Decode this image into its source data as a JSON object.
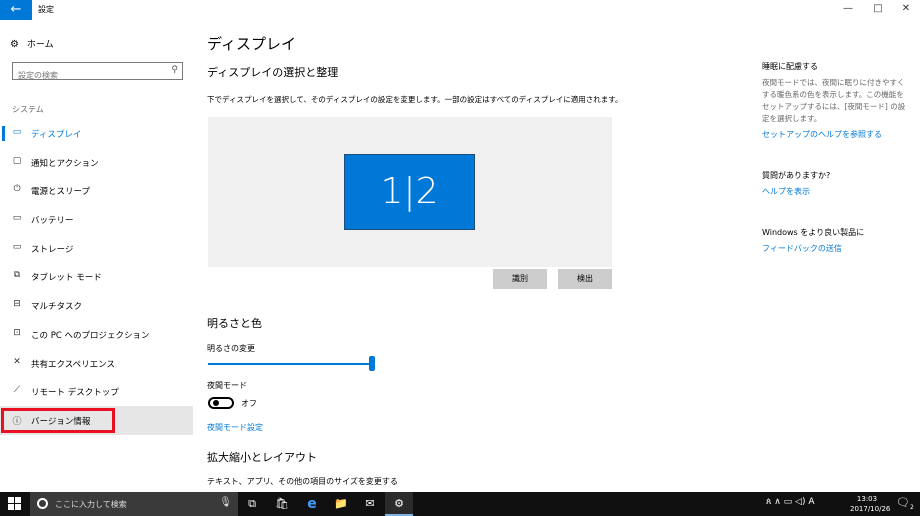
{
  "window": {
    "back_icon": "←",
    "title": "設定",
    "minimize": "—",
    "maximize": "□",
    "close": "✕"
  },
  "sidebar": {
    "home_icon": "⚙",
    "home_label": "ホーム",
    "search_placeholder": "設定の検索",
    "search_icon": "⚲",
    "section": "システム",
    "items": [
      {
        "icon": "▭",
        "label": "ディスプレイ"
      },
      {
        "icon": "▢",
        "label": "通知とアクション"
      },
      {
        "icon": "⏻",
        "label": "電源とスリープ"
      },
      {
        "icon": "▭",
        "label": "バッテリー"
      },
      {
        "icon": "▭",
        "label": "ストレージ"
      },
      {
        "icon": "⧉",
        "label": "タブレット モード"
      },
      {
        "icon": "⊟",
        "label": "マルチタスク"
      },
      {
        "icon": "⊡",
        "label": "この PC へのプロジェクション"
      },
      {
        "icon": "✕",
        "label": "共有エクスペリエンス"
      },
      {
        "icon": "⟋",
        "label": "リモート デスクトップ"
      },
      {
        "icon": "ⓘ",
        "label": "バージョン情報"
      }
    ]
  },
  "main": {
    "title": "ディスプレイ",
    "subtitle": "ディスプレイの選択と整理",
    "description": "下でディスプレイを選択して、そのディスプレイの設定を変更します。一部の設定はすべてのディスプレイに適用されます。",
    "monitor_label": "1|2",
    "identify_button": "識別",
    "detect_button": "検出",
    "brightness_section": "明るさと色",
    "brightness_label": "明るさの変更",
    "brightness_level": 1.0,
    "night_mode_label": "夜間モード",
    "night_mode_state": "オフ",
    "night_mode_link": "夜間モード設定",
    "scale_section": "拡大縮小とレイアウト",
    "scale_desc": "テキスト、アプリ、その他の項目のサイズを変更する"
  },
  "right": {
    "sleep_head": "睡眠に配慮する",
    "sleep_text": "夜間モードでは、夜間に眠りに付きやすくする暖色系の色を表示します。この機能をセットアップするには、[夜間モード] の設定を選択します。",
    "sleep_link": "セットアップのヘルプを参照する",
    "question_head": "質問がありますか?",
    "question_link": "ヘルプを表示",
    "improve_head": "Windows をより良い製品に",
    "improve_link": "フィードバックの送信"
  },
  "taskbar": {
    "search_text": "ここに入力して検索",
    "mic_icon": "🎙",
    "task_view_icon": "⧉",
    "store_icon": "🛍",
    "edge_icon": "e",
    "explorer_icon": "📁",
    "mail_icon": "✉",
    "settings_icon": "⚙",
    "tray_icons": "ጰ  ∧  ▭  ◁)  A",
    "time": "13:03",
    "date": "2017/10/26",
    "notification_icon": "🗨",
    "notification_count": "2"
  },
  "colors": {
    "accent": "#0078d7",
    "highlight_red": "#e81123",
    "taskbar": "#101010"
  }
}
